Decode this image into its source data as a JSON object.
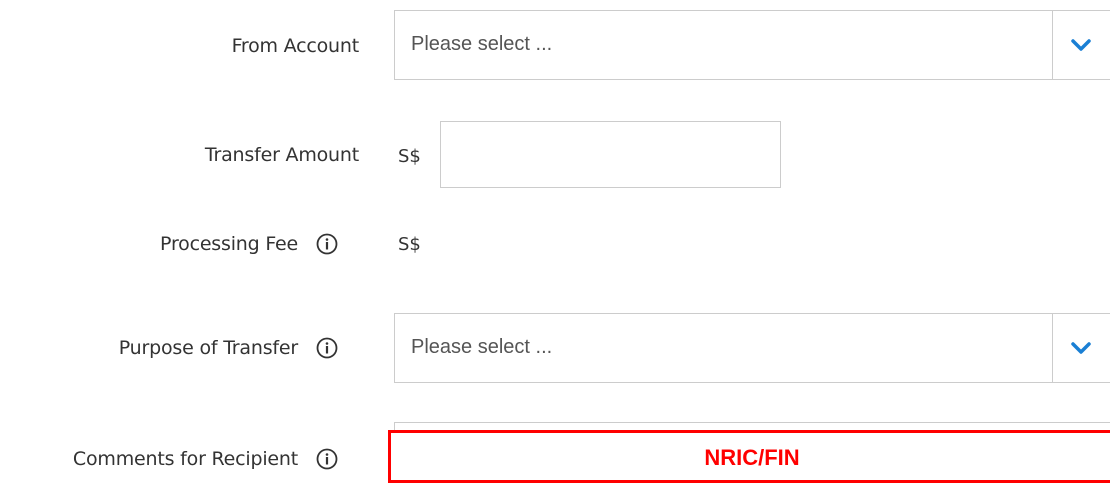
{
  "form": {
    "from_account": {
      "label": "From Account",
      "placeholder": "Please select ..."
    },
    "transfer_amount": {
      "label": "Transfer Amount",
      "currency": "S$",
      "value": ""
    },
    "processing_fee": {
      "label": "Processing Fee",
      "currency": "S$",
      "value": ""
    },
    "purpose": {
      "label": "Purpose of Transfer",
      "placeholder": "Please select ..."
    },
    "comments": {
      "label": "Comments for Recipient",
      "redaction_label": "NRIC/FIN"
    }
  },
  "icons": {
    "info": "info-circle-icon",
    "dropdown": "chevron-down-icon"
  },
  "colors": {
    "accent": "#1a7fd4",
    "border": "#cccccc",
    "text": "#333333",
    "placeholder": "#555555",
    "redaction": "#ff0000"
  }
}
